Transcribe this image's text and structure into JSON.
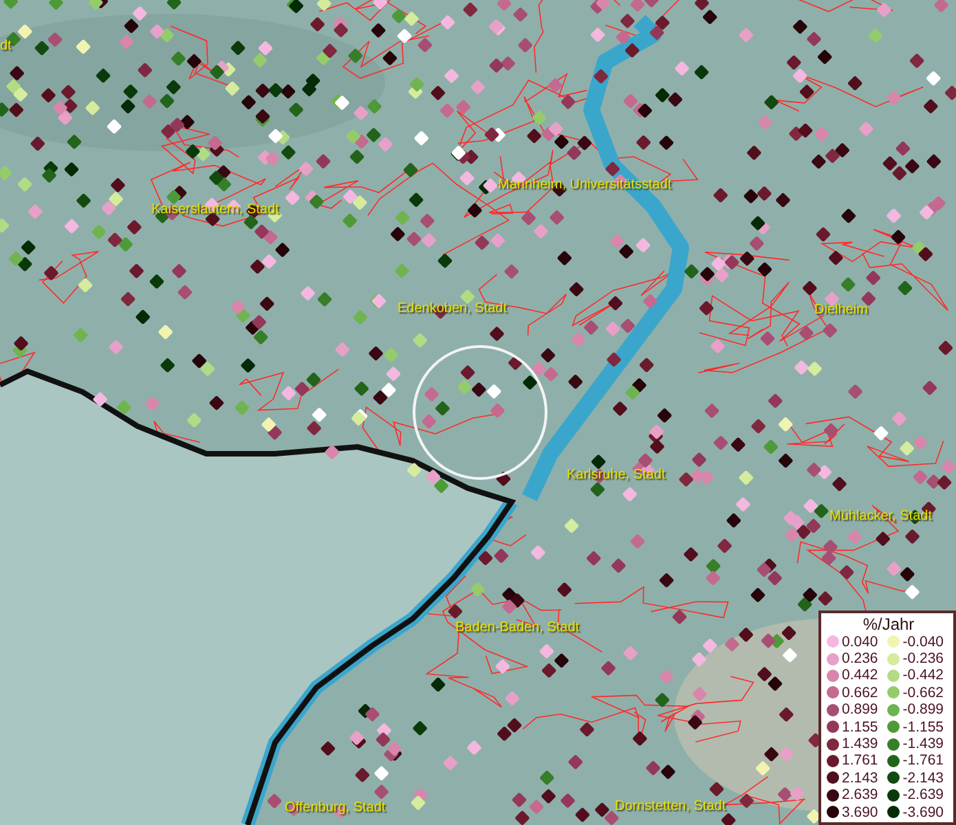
{
  "map": {
    "place_labels": [
      "dt",
      "Mannheim, Universitätsstadt",
      "Kaiserslautern, Stadt",
      "Edenkoben, Stadt",
      "Dielheim",
      "Karlsruhe, Stadt",
      "Mühlacker, Stadt",
      "Baden-Baden, Stadt",
      "Offenburg, Stadt",
      "Dornstetten, Stadt"
    ]
  },
  "legend": {
    "title": "%/Jahr",
    "rows": [
      {
        "left": {
          "label": "0.040",
          "color": "#f4b8e0"
        },
        "right": {
          "label": "-0.040",
          "color": "#f0f4b0"
        }
      },
      {
        "left": {
          "label": "0.236",
          "color": "#e8a0c8"
        },
        "right": {
          "label": "-0.236",
          "color": "#d4ec9c"
        }
      },
      {
        "left": {
          "label": "0.442",
          "color": "#d886ac"
        },
        "right": {
          "label": "-0.442",
          "color": "#b2dc84"
        }
      },
      {
        "left": {
          "label": "0.662",
          "color": "#c46a90"
        },
        "right": {
          "label": "-0.662",
          "color": "#94cc6c"
        }
      },
      {
        "left": {
          "label": "0.899",
          "color": "#a84e72"
        },
        "right": {
          "label": "-0.899",
          "color": "#70b450"
        }
      },
      {
        "left": {
          "label": "1.155",
          "color": "#94385a"
        },
        "right": {
          "label": "-1.155",
          "color": "#4e9a38"
        }
      },
      {
        "left": {
          "label": "1.439",
          "color": "#80283f"
        },
        "right": {
          "label": "-1.439",
          "color": "#367e28"
        }
      },
      {
        "left": {
          "label": "1.761",
          "color": "#6a1a2c"
        },
        "right": {
          "label": "-1.761",
          "color": "#22641a"
        }
      },
      {
        "left": {
          "label": "2.143",
          "color": "#520e1c"
        },
        "right": {
          "label": "-2.143",
          "color": "#124a10"
        }
      },
      {
        "left": {
          "label": "2.639",
          "color": "#3a0812"
        },
        "right": {
          "label": "-2.639",
          "color": "#0a3a0a"
        }
      },
      {
        "left": {
          "label": "3.690",
          "color": "#26040a"
        },
        "right": {
          "label": "-3.690",
          "color": "#042a06"
        }
      }
    ]
  }
}
